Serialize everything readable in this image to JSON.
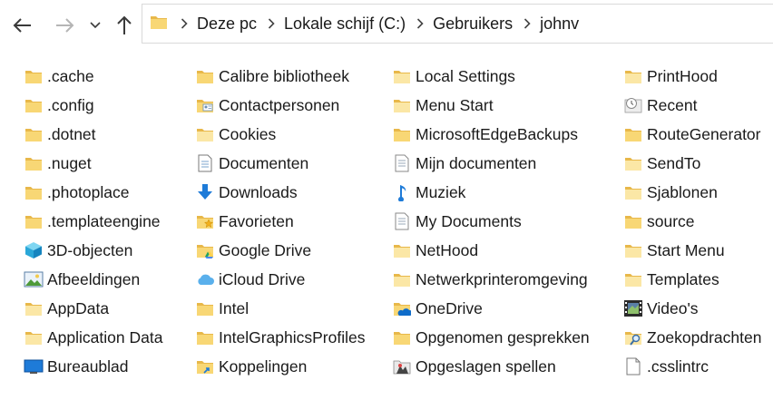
{
  "nav": {
    "breadcrumb": [
      "Deze pc",
      "Lokale schijf (C:)",
      "Gebruikers",
      "johnv"
    ]
  },
  "columns": [
    [
      {
        "label": ".cache",
        "icon": "folder-icon"
      },
      {
        "label": ".config",
        "icon": "folder-icon"
      },
      {
        "label": ".dotnet",
        "icon": "folder-icon"
      },
      {
        "label": ".nuget",
        "icon": "folder-icon"
      },
      {
        "label": ".photoplace",
        "icon": "folder-icon"
      },
      {
        "label": ".templateengine",
        "icon": "folder-icon"
      },
      {
        "label": "3D-objecten",
        "icon": "cube-3d-icon"
      },
      {
        "label": "Afbeeldingen",
        "icon": "pictures-icon"
      },
      {
        "label": "AppData",
        "icon": "folder-light-icon"
      },
      {
        "label": "Application Data",
        "icon": "folder-shortcut-icon"
      },
      {
        "label": "Bureaublad",
        "icon": "desktop-icon"
      }
    ],
    [
      {
        "label": "Calibre bibliotheek",
        "icon": "folder-icon"
      },
      {
        "label": "Contactpersonen",
        "icon": "contacts-folder-icon"
      },
      {
        "label": "Cookies",
        "icon": "folder-shortcut-icon"
      },
      {
        "label": "Documenten",
        "icon": "documents-icon"
      },
      {
        "label": "Downloads",
        "icon": "download-arrow-icon"
      },
      {
        "label": "Favorieten",
        "icon": "favorites-folder-icon"
      },
      {
        "label": "Google Drive",
        "icon": "google-drive-folder-icon"
      },
      {
        "label": "iCloud Drive",
        "icon": "icloud-icon"
      },
      {
        "label": "Intel",
        "icon": "folder-icon"
      },
      {
        "label": "IntelGraphicsProfiles",
        "icon": "folder-icon"
      },
      {
        "label": "Koppelingen",
        "icon": "links-folder-icon"
      }
    ],
    [
      {
        "label": "Local Settings",
        "icon": "folder-shortcut-icon"
      },
      {
        "label": "Menu Start",
        "icon": "folder-shortcut-icon"
      },
      {
        "label": "MicrosoftEdgeBackups",
        "icon": "folder-icon"
      },
      {
        "label": "Mijn documenten",
        "icon": "document-shortcut-icon"
      },
      {
        "label": "Muziek",
        "icon": "music-note-icon"
      },
      {
        "label": "My Documents",
        "icon": "document-shortcut-icon"
      },
      {
        "label": "NetHood",
        "icon": "folder-shortcut-icon"
      },
      {
        "label": "Netwerkprinteromgeving",
        "icon": "folder-shortcut-icon"
      },
      {
        "label": "OneDrive",
        "icon": "onedrive-folder-icon"
      },
      {
        "label": "Opgenomen gesprekken",
        "icon": "folder-icon"
      },
      {
        "label": "Opgeslagen spellen",
        "icon": "saved-games-icon"
      }
    ],
    [
      {
        "label": "PrintHood",
        "icon": "folder-shortcut-icon"
      },
      {
        "label": "Recent",
        "icon": "recent-icon"
      },
      {
        "label": "RouteGenerator",
        "icon": "folder-icon"
      },
      {
        "label": "SendTo",
        "icon": "folder-shortcut-icon"
      },
      {
        "label": "Sjablonen",
        "icon": "folder-shortcut-icon"
      },
      {
        "label": "source",
        "icon": "folder-icon"
      },
      {
        "label": "Start Menu",
        "icon": "folder-shortcut-icon"
      },
      {
        "label": "Templates",
        "icon": "folder-shortcut-icon"
      },
      {
        "label": "Video's",
        "icon": "video-film-icon"
      },
      {
        "label": "Zoekopdrachten",
        "icon": "search-folder-icon"
      },
      {
        "label": ".csslintrc",
        "icon": "file-icon"
      }
    ]
  ],
  "colors": {
    "folder": "#F8D775",
    "folder_dark": "#E8B84A",
    "folder_light": "#FBE7A6",
    "blue": "#1E7BD8"
  }
}
